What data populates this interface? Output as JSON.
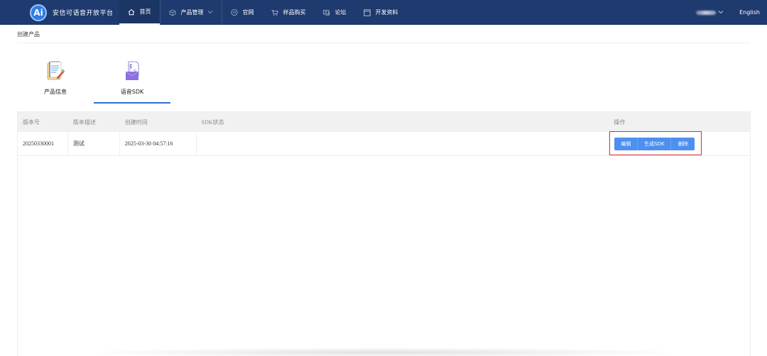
{
  "topbar": {
    "brand_logo": "Ai",
    "brand_name": "安信可语音开放平台",
    "nav": [
      {
        "label": "首页",
        "icon": "home-icon",
        "active": true
      },
      {
        "label": "产品管理",
        "icon": "box-icon",
        "dropdown": true
      },
      {
        "label": "官网",
        "icon": "ai-circle-icon"
      },
      {
        "label": "样品购买",
        "icon": "cart-icon"
      },
      {
        "label": "论坛",
        "icon": "chat-icon"
      },
      {
        "label": "开发资料",
        "icon": "doc-icon"
      }
    ],
    "language": "English"
  },
  "breadcrumb": "创建产品",
  "tabs": [
    {
      "label": "产品信息",
      "icon": "notebook-icon"
    },
    {
      "label": "语音SDK",
      "icon": "sdk-file-icon",
      "active": true
    }
  ],
  "table": {
    "headers": [
      "版本号",
      "版本描述",
      "创建时间",
      "SDK状态",
      "操作"
    ],
    "rows": [
      {
        "version": "20250330001",
        "description": "测试",
        "created": "2025-03-30 04:57:16",
        "status": ""
      }
    ],
    "actions": {
      "edit": "编辑",
      "generate": "生成SDK",
      "delete": "删除"
    }
  },
  "colors": {
    "topbar": "#1e3a6e",
    "accent": "#2d6fd6",
    "button": "#4d90f0",
    "highlight_box": "#e0282e"
  }
}
